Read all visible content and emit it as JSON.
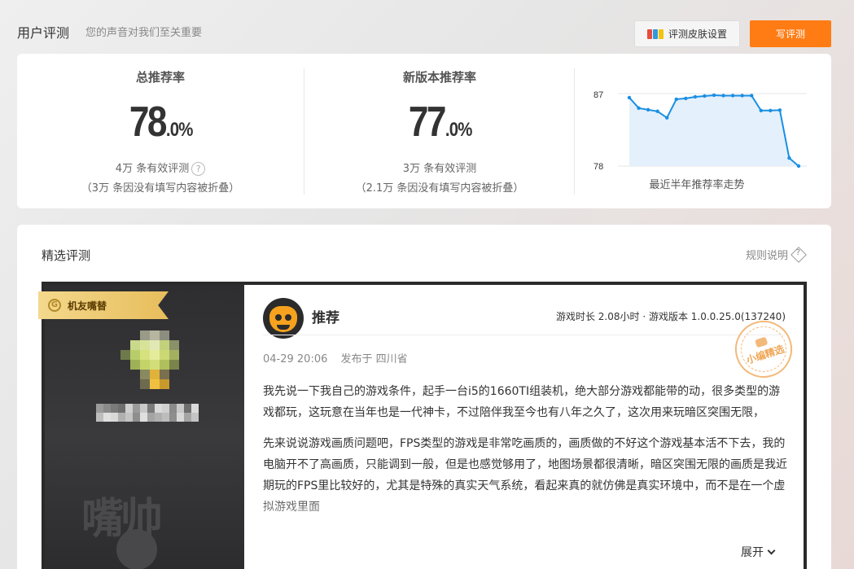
{
  "header": {
    "title": "用户评测",
    "subtitle": "您的声音对我们至关重要",
    "skin_button": "评测皮肤设置",
    "write_button": "写评测"
  },
  "stats": {
    "total": {
      "label": "总推荐率",
      "rate_int": "78",
      "rate_dec": ".0%",
      "count": "4万 条有效评测",
      "folded": "（3万 条因没有填写内容被折叠）"
    },
    "new_version": {
      "label": "新版本推荐率",
      "rate_int": "77",
      "rate_dec": ".0%",
      "count": "3万 条有效评测",
      "folded": "（2.1万 条因没有填写内容被折叠）"
    },
    "trend": {
      "caption": "最近半年推荐率走势",
      "y_max_label": "87",
      "y_min_label": "78"
    }
  },
  "chart_data": {
    "type": "area",
    "title": "最近半年推荐率走势",
    "ylim": [
      78,
      87
    ],
    "values": [
      86.5,
      85.2,
      85.0,
      84.8,
      84.0,
      86.3,
      86.4,
      86.6,
      86.7,
      86.8,
      86.75,
      86.75,
      86.75,
      86.75,
      84.9,
      84.9,
      84.95,
      79.0,
      78.0
    ],
    "color": "#1a8fe3"
  },
  "reviews": {
    "section_title": "精选评测",
    "rules_label": "规则说明",
    "featured": {
      "badge": "机友嘴替",
      "verdict": "推荐",
      "playinfo": "游戏时长 2.08小时 · 游戏版本 1.0.0.25.0(137240)",
      "date": "04-29 20:06",
      "location": "发布于 四川省",
      "stamp": "小编精选",
      "paragraphs": [
        "我先说一下我自己的游戏条件，起手一台i5的1660TI组装机，绝大部分游戏都能带的动，很多类型的游戏都玩，这玩意在当年也是一代神卡，不过陪伴我至今也有八年之久了，这次用来玩暗区突围无限，",
        "先来说说游戏画质问题吧，FPS类型的游戏是非常吃画质的，画质做的不好这个游戏基本活不下去，我的电脑开不了高画质，只能调到一般，但是也感觉够用了，地图场景都很清晰，暗区突围无限的画质是我近期玩的FPS里比较好的，尤其是特殊的真实天气系统，看起来真的就仿佛是真实环境中，而不是在一个虚拟游戏里面"
      ],
      "expand_label": "展开",
      "watermark": "嘴帅"
    }
  }
}
